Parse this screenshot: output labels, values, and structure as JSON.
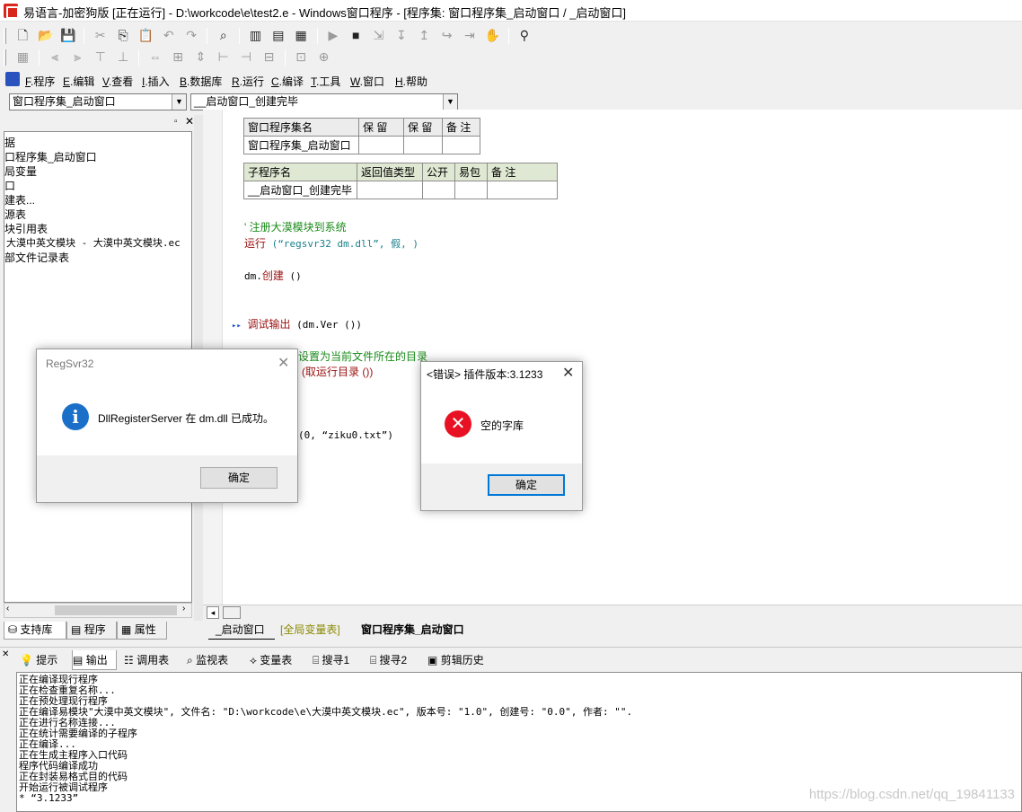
{
  "window": {
    "title": "易语言-加密狗版 [正在运行] - D:\\workcode\\e\\test2.e - Windows窗口程序 - [程序集: 窗口程序集_启动窗口 / _启动窗口]"
  },
  "menubar": {
    "items": [
      {
        "key": "F",
        "label": ".程序"
      },
      {
        "key": "E",
        "label": ".编辑"
      },
      {
        "key": "V",
        "label": ".查看"
      },
      {
        "key": "I",
        "label": ".插入"
      },
      {
        "key": "B",
        "label": ".数据库"
      },
      {
        "key": "R",
        "label": ".运行"
      },
      {
        "key": "C",
        "label": ".编译"
      },
      {
        "key": "T",
        "label": ".工具"
      },
      {
        "key": "W",
        "label": ".窗口"
      },
      {
        "key": "H",
        "label": ".帮助"
      }
    ]
  },
  "selectors": {
    "left": "窗口程序集_启动窗口",
    "right": "__启动窗口_创建完毕"
  },
  "tree": {
    "items": [
      "据",
      "口程序集_启动窗口",
      "局变量",
      "口",
      "建表...",
      "源表",
      "块引用表",
      "大漠中英文模块 - 大漠中英文模块.ec",
      "部文件记录表"
    ]
  },
  "left_tabs": [
    "支持库",
    "程序",
    "属性"
  ],
  "assembly_table": {
    "headers": [
      "窗口程序集名",
      "保 留",
      "保 留",
      "备 注"
    ],
    "row": [
      "窗口程序集_启动窗口",
      "",
      "",
      ""
    ]
  },
  "sub_table": {
    "headers": [
      "子程序名",
      "返回值类型",
      "公开",
      "易包",
      "备 注"
    ],
    "row": [
      "__启动窗口_创建完毕",
      "",
      "",
      "",
      ""
    ]
  },
  "code": {
    "comment1": "' 注册大漠模块到系统",
    "run_kw": "运行",
    "run_args": "(“regsvr32 dm.dll”, 假, )",
    "create_obj": "dm.",
    "create_kw": "创建",
    "create_args": " ()",
    "debug_marker": "▸▸",
    "debug_kw": "调试输出",
    "debug_args": " (dm.Ver ())",
    "comment2": "设置为当前文件所在的目录",
    "setpath_args": "(取运行目录 ())",
    "dict_args": "(0, “ziku0.txt”)"
  },
  "editor_tabs": [
    "_启动窗口",
    "[全局变量表]",
    "窗口程序集_启动窗口"
  ],
  "output_tabs": [
    "提示",
    "输出",
    "调用表",
    "监视表",
    "变量表",
    "搜寻1",
    "搜寻2",
    "剪辑历史"
  ],
  "output_lines": [
    "正在编译现行程序",
    "正在检查重复名称...",
    "正在预处理现行程序",
    "正在编译易模块\"大漠中英文模块\", 文件名: \"D:\\workcode\\e\\大漠中英文模块.ec\", 版本号: \"1.0\", 创建号: \"0.0\", 作者: \"\".",
    "正在进行名称连接...",
    "正在统计需要编译的子程序",
    "正在编译...",
    "正在生成主程序入口代码",
    "程序代码编译成功",
    "正在封装易格式目的代码",
    "开始运行被调试程序",
    "* “3.1233”"
  ],
  "watermark": "https://blog.csdn.net/qq_19841133",
  "dialog_regsvr": {
    "title": "RegSvr32",
    "message": "DllRegisterServer 在 dm.dll 已成功。",
    "ok": "确定",
    "icon": "info-icon"
  },
  "dialog_error": {
    "title": "<错误> 插件版本:3.1233",
    "message": "空的字库",
    "ok": "确定",
    "icon": "error-icon"
  }
}
